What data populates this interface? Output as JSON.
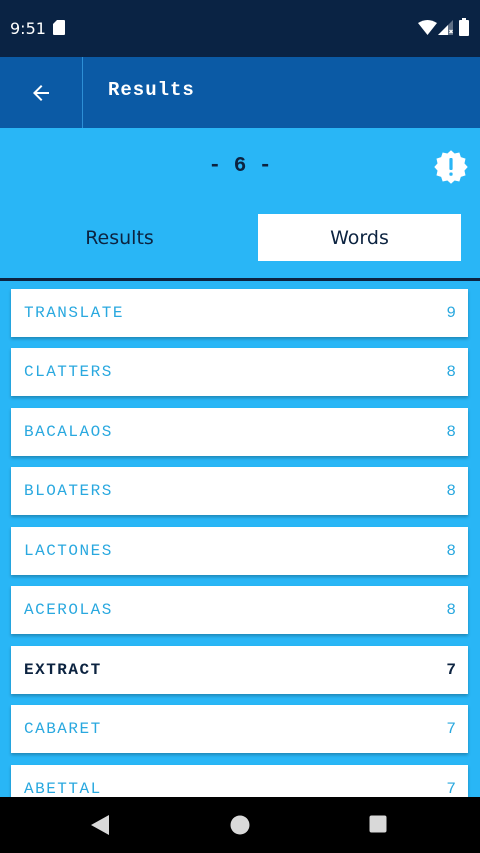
{
  "status_bar": {
    "time": "9:51"
  },
  "app_bar": {
    "title": "Results",
    "back_icon": "arrow-left-icon"
  },
  "score": {
    "display": "- 6 -",
    "alert_icon": "alert-badge-icon"
  },
  "tabs": [
    {
      "label": "Results",
      "selected": false
    },
    {
      "label": "Words",
      "selected": true
    }
  ],
  "words": [
    {
      "word": "TRANSLATE",
      "score": "9",
      "found": false
    },
    {
      "word": "CLATTERS",
      "score": "8",
      "found": false
    },
    {
      "word": "BACALAOS",
      "score": "8",
      "found": false
    },
    {
      "word": "BLOATERS",
      "score": "8",
      "found": false
    },
    {
      "word": "LACTONES",
      "score": "8",
      "found": false
    },
    {
      "word": "ACEROLAS",
      "score": "8",
      "found": false
    },
    {
      "word": "EXTRACT",
      "score": "7",
      "found": true
    },
    {
      "word": "CABARET",
      "score": "7",
      "found": false
    },
    {
      "word": "ABETTAL",
      "score": "7",
      "found": false
    }
  ],
  "colors": {
    "status_bar": "#0a2344",
    "app_bar": "#0b5aa5",
    "background": "#29b6f6",
    "dark_text": "#0c2340",
    "word_text": "#29a8df"
  }
}
